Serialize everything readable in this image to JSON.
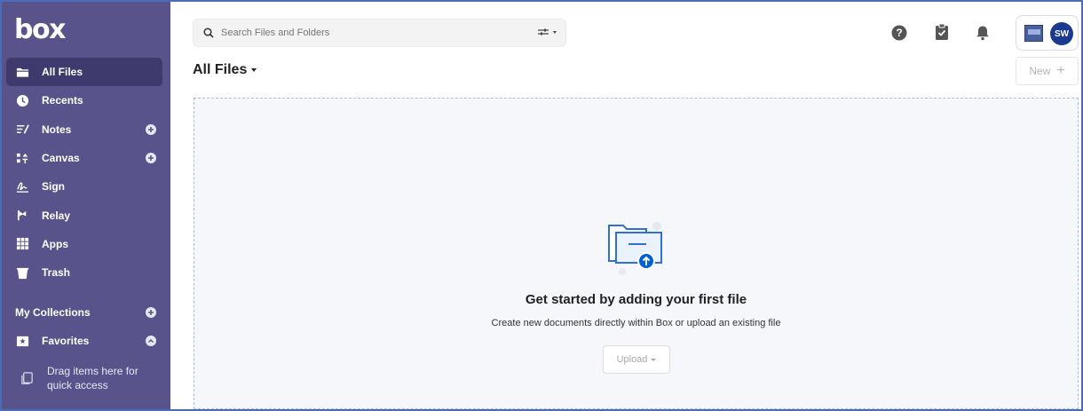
{
  "app": {
    "logo": "box"
  },
  "sidebar": {
    "items": [
      {
        "label": "All Files",
        "icon": "folder-icon",
        "active": true
      },
      {
        "label": "Recents",
        "icon": "clock-icon"
      },
      {
        "label": "Notes",
        "icon": "notes-icon",
        "add": true
      },
      {
        "label": "Canvas",
        "icon": "canvas-icon",
        "add": true
      },
      {
        "label": "Sign",
        "icon": "signature-icon"
      },
      {
        "label": "Relay",
        "icon": "relay-icon"
      },
      {
        "label": "Apps",
        "icon": "apps-grid-icon"
      },
      {
        "label": "Trash",
        "icon": "trash-icon"
      }
    ],
    "collections_label": "My Collections",
    "favorites_label": "Favorites",
    "drag_hint": "Drag items here for quick access"
  },
  "header": {
    "search_placeholder": "Search Files and Folders",
    "avatar_initials": "SW",
    "page_title": "All Files",
    "new_label": "New"
  },
  "empty_state": {
    "title": "Get started by adding your first file",
    "subtitle": "Create new documents directly within Box or upload an existing file",
    "upload_label": "Upload"
  },
  "colors": {
    "sidebar_bg": "#58538a",
    "sidebar_active": "#3f3a6e",
    "accent": "#0061d5",
    "avatar_bg": "#1a3a8f"
  }
}
